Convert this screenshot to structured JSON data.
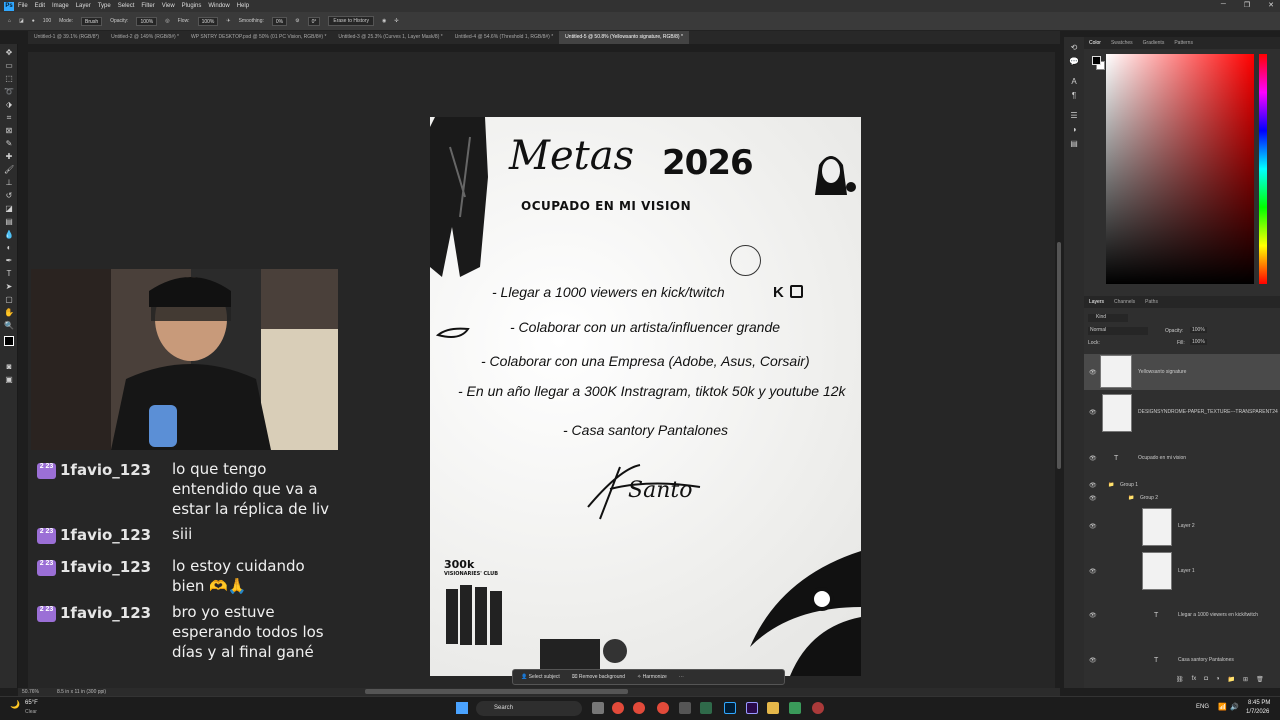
{
  "menubar": {
    "logo": "Ps",
    "items": [
      "File",
      "Edit",
      "Image",
      "Layer",
      "Type",
      "Select",
      "Filter",
      "View",
      "Plugins",
      "Window",
      "Help"
    ]
  },
  "options": {
    "mode_label": "Mode:",
    "mode_value": "Brush",
    "opacity_label": "Opacity:",
    "opacity_value": "100%",
    "flow_label": "Flow:",
    "flow_value": "100%",
    "smoothing_label": "Smoothing:",
    "smoothing_value": "0%",
    "angle_value": "0°",
    "brush_size": "100",
    "erase_history": "Erase to History"
  },
  "tabs": [
    "Untitled-1 @ 39.1% (RGB/8*)",
    "Untitled-2 @ 149% (RGB/8#) *",
    "WP SNTRY DESKTOP.psd @ 50% (01 PC Vision, RGB/8#) *",
    "Untitled-3 @ 25.3% (Curves 1, Layer Mask/8) *",
    "Untitled-4 @ 54.6% (Threshold 1, RGB/8#) *",
    "Untitled-5 @ 50.8% (Yellowsanto signature, RGB/8) *"
  ],
  "document": {
    "title_script": "Metas",
    "title_year": "2026",
    "subtitle": "OCUPADO EN MI VISION",
    "goals": [
      "- Llegar a 1000 viewers en kick/twitch",
      "- Colaborar con un artista/influencer grande",
      "- Colaborar con una Empresa (Adobe, Asus, Corsair)",
      "- En un año llegar a 300K Instragram, tiktok 50k  y youtube 12k",
      "- Casa santory Pantalones"
    ],
    "signature": "Santo",
    "club_count": "300k",
    "club_name": "VISIONARIES' CLUB",
    "kick_glyph": "K"
  },
  "contextbar": {
    "select_subject": "Select subject",
    "remove_background": "Remove background",
    "harmonize": "Harmonize"
  },
  "status": {
    "zoom": "50.76%",
    "doc_size": "8.5 in x 11 in (300 ppi)"
  },
  "panel": {
    "color_tabs": [
      "Color",
      "Swatches",
      "Gradients",
      "Patterns"
    ],
    "layer_tabs": [
      "Layers",
      "Channels",
      "Paths"
    ],
    "kind": "Kind",
    "blend": "Normal",
    "opacity_label": "Opacity:",
    "opacity_value": "100%",
    "lock_label": "Lock:",
    "fill_label": "Fill:",
    "fill_value": "100%",
    "layers": [
      {
        "name": "Yellowsanto signature"
      },
      {
        "name": "DESIGNSYNDROME-PAPER_TEXTURE---TRANSPARENT24"
      },
      {
        "name": "Ocupado en mi vision"
      },
      {
        "name": "Group 1"
      },
      {
        "name": "Group 2"
      },
      {
        "name": "Layer 2"
      },
      {
        "name": "Layer 1"
      },
      {
        "name": "Llegar a 1000 viewers en kick/twitch"
      },
      {
        "name": "Casa santory Pantalones"
      }
    ]
  },
  "chat": [
    {
      "badge": "2 23",
      "user": "1favio_123",
      "text": "lo que tengo entendido que va a estar la réplica de liv"
    },
    {
      "badge": "2 23",
      "user": "1favio_123",
      "text": "siii"
    },
    {
      "badge": "2 23",
      "user": "1favio_123",
      "text": "lo estoy cuidando bien 🫶🙏"
    },
    {
      "badge": "2 23",
      "user": "1favio_123",
      "text": "bro yo estuve esperando todos los días y al final gané"
    }
  ],
  "taskbar": {
    "weather_temp": "65°F",
    "weather_desc": "Clear",
    "search": "Search",
    "lang": "ENG",
    "time": "8:45 PM",
    "date": "1/7/2026"
  },
  "colors": {
    "ps_blue": "#31a8ff",
    "app_bg": "#1e1e1e",
    "panel_bg": "#2f2f2f",
    "badge_purple": "#9b6fd6"
  }
}
